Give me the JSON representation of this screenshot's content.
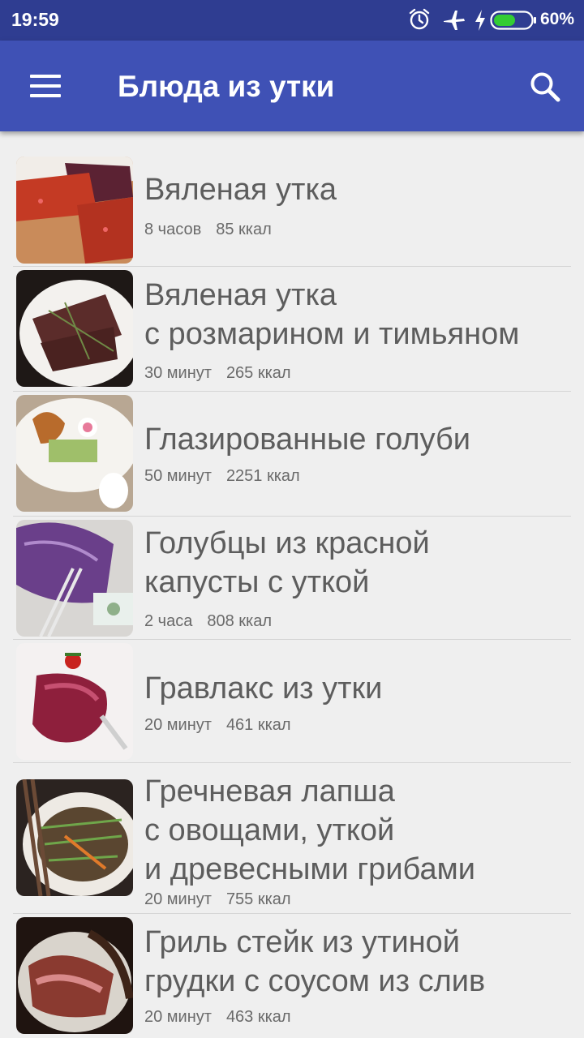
{
  "status_bar": {
    "time": "19:59",
    "battery_percent": "60%",
    "icons": [
      "alarm-icon",
      "airplane-mode-icon",
      "charging-icon",
      "battery-icon"
    ],
    "battery_level": 0.6,
    "colors": {
      "background": "#2f3d91",
      "battery_fill": "#33cc33"
    }
  },
  "app_bar": {
    "title": "Блюда из утки",
    "menu_icon": "hamburger-menu-icon",
    "search_icon": "search-icon",
    "color": "#3f51b5"
  },
  "recipes": [
    {
      "title_lines": [
        "Вяленая утка"
      ],
      "time": "8 часов",
      "kcal": "85 ккал"
    },
    {
      "title_lines": [
        "Вяленая утка",
        "с розмарином и тимьяном"
      ],
      "time": "30 минут",
      "kcal": "265 ккал"
    },
    {
      "title_lines": [
        "Глазированные голуби"
      ],
      "time": "50 минут",
      "kcal": "2251 ккал"
    },
    {
      "title_lines": [
        "Голубцы из красной",
        "капусты с уткой"
      ],
      "time": "2 часа",
      "kcal": "808 ккал"
    },
    {
      "title_lines": [
        "Гравлакс из утки"
      ],
      "time": "20 минут",
      "kcal": "461 ккал"
    },
    {
      "title_lines": [
        "Гречневая лапша",
        "с овощами, уткой",
        "и древесными грибами"
      ],
      "time": "20 минут",
      "kcal": "755 ккал"
    },
    {
      "title_lines": [
        "Гриль стейк из утиной",
        "грудки с соусом из слив"
      ],
      "time": "20 минут",
      "kcal": "463 ккал"
    }
  ]
}
